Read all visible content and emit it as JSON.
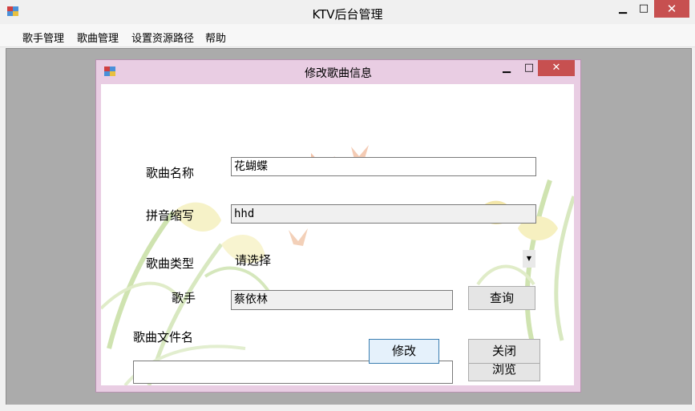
{
  "window": {
    "title": "KTV后台管理",
    "min": "▁",
    "max": "□",
    "close": "✕"
  },
  "menu": [
    {
      "label": "歌手管理"
    },
    {
      "label": "歌曲管理"
    },
    {
      "label": "设置资源路径"
    },
    {
      "label": "帮助"
    }
  ],
  "dialog": {
    "title": "修改歌曲信息",
    "min": "▁",
    "max": "□",
    "close": "✕",
    "fields": {
      "song_name_label": "歌曲名称",
      "song_name_value": "花蝴蝶",
      "pinyin_label": "拼音缩写",
      "pinyin_value": "hhd",
      "type_label": "歌曲类型",
      "type_value": "请选择",
      "singer_label": "歌手",
      "singer_value": "蔡依林",
      "file_label": "歌曲文件名",
      "file_value": ""
    },
    "buttons": {
      "query": "查询",
      "browse": "浏览",
      "modify": "修改",
      "close": "关闭"
    }
  }
}
